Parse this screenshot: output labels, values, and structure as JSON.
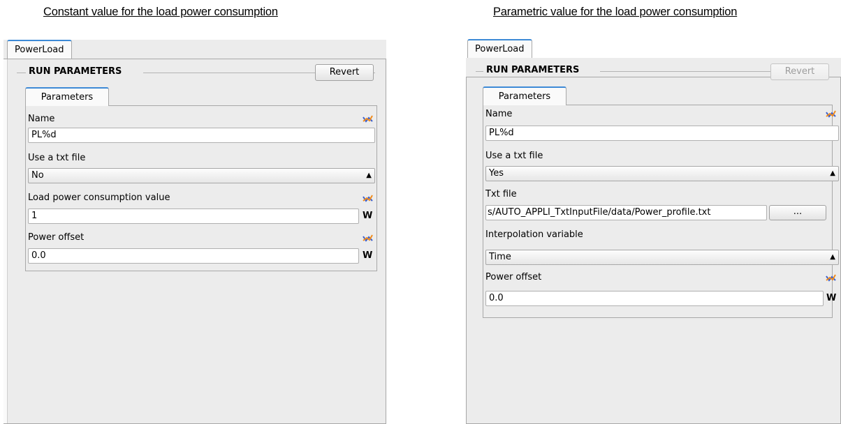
{
  "captions": {
    "left": "Constant value for the load power consumption",
    "right": "Parametric value for the load power consumption"
  },
  "left_panel": {
    "tab": "PowerLoad",
    "group_title": "RUN PARAMETERS",
    "revert_label": "Revert",
    "revert_enabled": true,
    "inner_tab": "Parameters",
    "name_label": "Name",
    "name_value": "PL%d",
    "txt_label": "Use a txt file",
    "txt_value": "No",
    "load_label": "Load power consumption value",
    "load_value": "1",
    "load_unit": "W",
    "offset_label": "Power offset",
    "offset_value": "0.0",
    "offset_unit": "W"
  },
  "right_panel": {
    "tab": "PowerLoad",
    "group_title": "RUN PARAMETERS",
    "revert_label": "Revert",
    "revert_enabled": false,
    "inner_tab": "Parameters",
    "name_label": "Name",
    "name_value": "PL%d",
    "txt_label": "Use a txt file",
    "txt_value": "Yes",
    "file_label": "Txt file",
    "file_value": "s/AUTO_APPLI_TxtInputFile/data/Power_profile.txt",
    "browse_label": "...",
    "interp_label": "Interpolation variable",
    "interp_value": "Time",
    "offset_label": "Power offset",
    "offset_value": "0.0",
    "offset_unit": "W"
  },
  "icons": {
    "parametric": "trend-line-icon",
    "select_arrows": "up-down-arrows-icon"
  },
  "colors": {
    "tab_accent": "#3d8ad6",
    "panel_bg": "#ececec",
    "trend_blue": "#3a5fcd",
    "trend_orange": "#f08c1e"
  }
}
